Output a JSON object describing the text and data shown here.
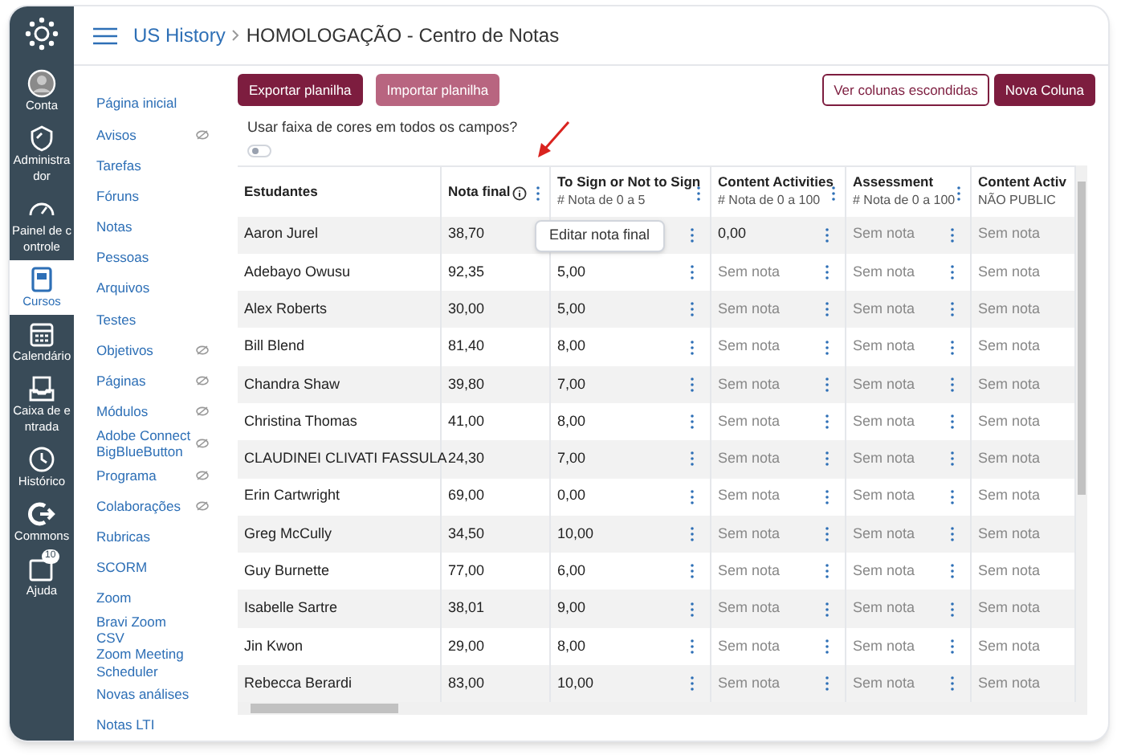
{
  "global_nav": [
    {
      "label": "Conta",
      "selected": false
    },
    {
      "label": "Administrador",
      "selected": false
    },
    {
      "label": "Painel de controle",
      "selected": false
    },
    {
      "label": "Cursos",
      "selected": true
    },
    {
      "label": "Calendário",
      "selected": false
    },
    {
      "label": "Caixa de entrada",
      "selected": false
    },
    {
      "label": "Histórico",
      "selected": false
    },
    {
      "label": "Commons",
      "selected": false
    },
    {
      "label": "Ajuda",
      "selected": false,
      "badge": "10"
    }
  ],
  "breadcrumbs": [
    "US History",
    "HOMOLOGAÇÃO - Centro de Notas"
  ],
  "course_nav": [
    {
      "label": "Página inicial",
      "hidden": false
    },
    {
      "label": "Avisos",
      "hidden": true
    },
    {
      "label": "Tarefas",
      "hidden": false
    },
    {
      "label": "Fóruns",
      "hidden": false
    },
    {
      "label": "Notas",
      "hidden": false
    },
    {
      "label": "Pessoas",
      "hidden": false
    },
    {
      "label": "Arquivos",
      "hidden": false
    },
    {
      "label": "Testes",
      "hidden": false
    },
    {
      "label": "Objetivos",
      "hidden": true
    },
    {
      "label": "Páginas",
      "hidden": true
    },
    {
      "label": "Módulos",
      "hidden": true
    },
    {
      "label": "Adobe Connect BigBlueButton",
      "hidden": true
    },
    {
      "label": "Programa",
      "hidden": true
    },
    {
      "label": "Colaborações",
      "hidden": true
    },
    {
      "label": "Rubricas",
      "hidden": false
    },
    {
      "label": "SCORM",
      "hidden": false
    },
    {
      "label": "Zoom",
      "hidden": false
    },
    {
      "label": "Bravi Zoom CSV",
      "hidden": false
    },
    {
      "label": "Zoom Meeting Scheduler",
      "hidden": false
    },
    {
      "label": "Novas análises",
      "hidden": false
    },
    {
      "label": "Notas LTI",
      "hidden": false
    }
  ],
  "toolbar": {
    "left": [
      {
        "label": "Exportar planilha",
        "kind": "primary"
      },
      {
        "label": "Importar planilha",
        "kind": "muted"
      }
    ],
    "right": [
      {
        "label": "Ver colunas escondidas",
        "kind": "outline"
      },
      {
        "label": "Nova Coluna",
        "kind": "primary"
      }
    ]
  },
  "color_bands": {
    "label": "Usar faixa de cores em todos os campos?",
    "on": false
  },
  "popup": {
    "label": "Editar nota final"
  },
  "table": {
    "columns": [
      {
        "title": "Estudantes",
        "kind": "name"
      },
      {
        "title": "Nota final",
        "kind": "final"
      },
      {
        "title": "To Sign or Not to Sign",
        "subtitle": "# Nota de 0 a 5",
        "kind": "grade"
      },
      {
        "title": "Content Activities",
        "subtitle": "# Nota de 0 a 100",
        "kind": "grade"
      },
      {
        "title": "Assessment",
        "subtitle": "# Nota de 0 a 100",
        "kind": "grade"
      },
      {
        "title": "Content Activ",
        "subtitle": "NÃO PUBLIC",
        "kind": "cut"
      }
    ],
    "rows": [
      {
        "student": "Aaron Jurel",
        "final": "38,70",
        "scores": [
          {
            "v": "0,00",
            "muted": false
          },
          {
            "v": "Sem nota",
            "muted": true
          },
          {
            "v": "Sem nota",
            "muted": true
          }
        ]
      },
      {
        "student": "Adebayo Owusu",
        "final": "92,35",
        "scores": [
          {
            "v": "5,00",
            "muted": false
          },
          {
            "v": "Sem nota",
            "muted": true
          },
          {
            "v": "Sem nota",
            "muted": true
          },
          {
            "v": "Sem nota",
            "muted": true
          }
        ]
      },
      {
        "student": "Alex Roberts",
        "final": "30,00",
        "scores": [
          {
            "v": "5,00",
            "muted": false
          },
          {
            "v": "Sem nota",
            "muted": true
          },
          {
            "v": "Sem nota",
            "muted": true
          },
          {
            "v": "Sem nota",
            "muted": true
          }
        ]
      },
      {
        "student": "Bill Blend",
        "final": "81,40",
        "scores": [
          {
            "v": "8,00",
            "muted": false
          },
          {
            "v": "Sem nota",
            "muted": true
          },
          {
            "v": "Sem nota",
            "muted": true
          },
          {
            "v": "Sem nota",
            "muted": true
          }
        ]
      },
      {
        "student": "Chandra Shaw",
        "final": "39,80",
        "scores": [
          {
            "v": "7,00",
            "muted": false
          },
          {
            "v": "Sem nota",
            "muted": true
          },
          {
            "v": "Sem nota",
            "muted": true
          },
          {
            "v": "Sem nota",
            "muted": true
          }
        ]
      },
      {
        "student": "Christina Thomas",
        "final": "41,00",
        "scores": [
          {
            "v": "8,00",
            "muted": false
          },
          {
            "v": "Sem nota",
            "muted": true
          },
          {
            "v": "Sem nota",
            "muted": true
          },
          {
            "v": "Sem nota",
            "muted": true
          }
        ]
      },
      {
        "student": "CLAUDINEI CLIVATI FASSULA",
        "final": "24,30",
        "scores": [
          {
            "v": "7,00",
            "muted": false
          },
          {
            "v": "Sem nota",
            "muted": true
          },
          {
            "v": "Sem nota",
            "muted": true
          },
          {
            "v": "Sem nota",
            "muted": true
          }
        ]
      },
      {
        "student": "Erin Cartwright",
        "final": "69,00",
        "scores": [
          {
            "v": "0,00",
            "muted": false
          },
          {
            "v": "Sem nota",
            "muted": true
          },
          {
            "v": "Sem nota",
            "muted": true
          },
          {
            "v": "Sem nota",
            "muted": true
          }
        ]
      },
      {
        "student": "Greg McCully",
        "final": "34,50",
        "scores": [
          {
            "v": "10,00",
            "muted": false
          },
          {
            "v": "Sem nota",
            "muted": true
          },
          {
            "v": "Sem nota",
            "muted": true
          },
          {
            "v": "Sem nota",
            "muted": true
          }
        ]
      },
      {
        "student": "Guy Burnette",
        "final": "77,00",
        "scores": [
          {
            "v": "6,00",
            "muted": false
          },
          {
            "v": "Sem nota",
            "muted": true
          },
          {
            "v": "Sem nota",
            "muted": true
          },
          {
            "v": "Sem nota",
            "muted": true
          }
        ]
      },
      {
        "student": "Isabelle Sartre",
        "final": "38,01",
        "scores": [
          {
            "v": "9,00",
            "muted": false
          },
          {
            "v": "Sem nota",
            "muted": true
          },
          {
            "v": "Sem nota",
            "muted": true
          },
          {
            "v": "Sem nota",
            "muted": true
          }
        ]
      },
      {
        "student": "Jin Kwon",
        "final": "29,00",
        "scores": [
          {
            "v": "8,00",
            "muted": false
          },
          {
            "v": "Sem nota",
            "muted": true
          },
          {
            "v": "Sem nota",
            "muted": true
          },
          {
            "v": "Sem nota",
            "muted": true
          }
        ]
      },
      {
        "student": "Rebecca Berardi",
        "final": "83,00",
        "scores": [
          {
            "v": "10,00",
            "muted": false
          },
          {
            "v": "Sem nota",
            "muted": true
          },
          {
            "v": "Sem nota",
            "muted": true
          },
          {
            "v": "Sem nota",
            "muted": true
          }
        ]
      }
    ]
  }
}
